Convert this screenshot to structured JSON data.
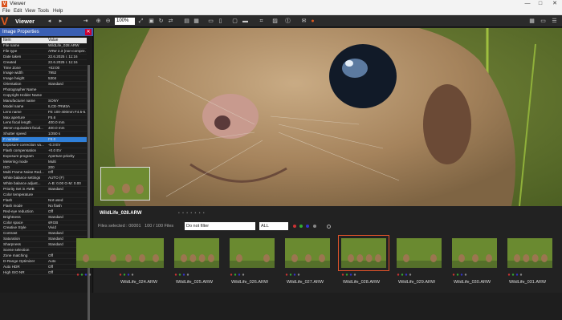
{
  "window": {
    "title": "Viewer",
    "logo_letter": "V",
    "controls": [
      "—",
      "□",
      "✕"
    ]
  },
  "menu": [
    "File",
    "Edit",
    "View",
    "Tools",
    "Help"
  ],
  "toolbar": {
    "mode_label": "Viewer",
    "zoom": "100%"
  },
  "panel": {
    "title": "Image Properties",
    "close_label": "✕",
    "col_item": "Item",
    "col_value": "Value",
    "properties": [
      [
        "File name",
        "WildLife_028.ARW"
      ],
      [
        "File type",
        "ARW 2.3 (non-compre..."
      ],
      [
        "Date taken",
        "22.6.2025 г. 11:16"
      ],
      [
        "Created",
        "22.6.2025 г. 11:16"
      ],
      [
        "Time Zone",
        "+02:00"
      ],
      [
        "Image width",
        "7952"
      ],
      [
        "Image height",
        "5304"
      ],
      [
        "Orientation",
        "Standard"
      ],
      [
        "Photographer Name",
        ""
      ],
      [
        "Copyright Holder Name",
        ""
      ],
      [
        "Manufacturer name",
        "SONY"
      ],
      [
        "Model name",
        "ILCE-7RM3A"
      ],
      [
        "Lens name",
        "FE 100-400mm F4.5-5..."
      ],
      [
        "Max aperture",
        "F5.6"
      ],
      [
        "Lens focal length",
        "400.0 mm"
      ],
      [
        "35mm equivalent focal...",
        "400.0 mm"
      ],
      [
        "Shutter speed",
        "1/250 s"
      ],
      [
        "F number",
        "F8.0"
      ],
      [
        "Exposure correction va...",
        "-0.3 EV"
      ],
      [
        "Flash compensation",
        "+0.0 EV"
      ],
      [
        "Exposure program",
        "Aperture priority"
      ],
      [
        "Metering mode",
        "Multi"
      ],
      [
        "ISO",
        "200"
      ],
      [
        "Multi Frame Noise Red...",
        "Off"
      ],
      [
        "White balance settings",
        "AUTO (F)"
      ],
      [
        "White balance adjust...",
        "A-B: 0.00 G-M: 0.00"
      ],
      [
        "Priority Set in AWB",
        "Standard"
      ],
      [
        "Color temperature",
        ""
      ],
      [
        "Flash",
        "Not used"
      ],
      [
        "Flash mode",
        "No flash"
      ],
      [
        "Red-eye reduction",
        "Off"
      ],
      [
        "Brightness",
        "Standard"
      ],
      [
        "Color space",
        "sRGB"
      ],
      [
        "Creative Style",
        "Vivid"
      ],
      [
        "Contrast",
        "Standard"
      ],
      [
        "Saturation",
        "Standard"
      ],
      [
        "Sharpness",
        "Standard"
      ],
      [
        "Scene selection",
        ""
      ],
      [
        "Zone matching",
        "Off"
      ],
      [
        "D-Range Optimizer",
        "Auto"
      ],
      [
        "Auto HDR",
        "Off"
      ],
      [
        "High ISO NR",
        "Off"
      ]
    ],
    "selected_index": 17
  },
  "viewer": {
    "filename": "WildLife_028.ARW"
  },
  "strip": {
    "files_selected": "Files selected : 00001",
    "count": "100 / 100 Files",
    "filter": "Do not filter",
    "filter_all": "ALL",
    "thumbs": [
      "",
      "WildLife_024.ARW",
      "WildLife_025.ARW",
      "WildLife_026.ARW",
      "WildLife_027.ARW",
      "WildLife_028.ARW",
      "WildLife_029.ARW",
      "WildLife_030.ARW",
      "WildLife_031.ARW"
    ],
    "selected_thumb": 5
  },
  "colors": {
    "accent": "#e05a1f",
    "selection": "#2f7fd8",
    "panel_header": "#3a5fb3"
  }
}
